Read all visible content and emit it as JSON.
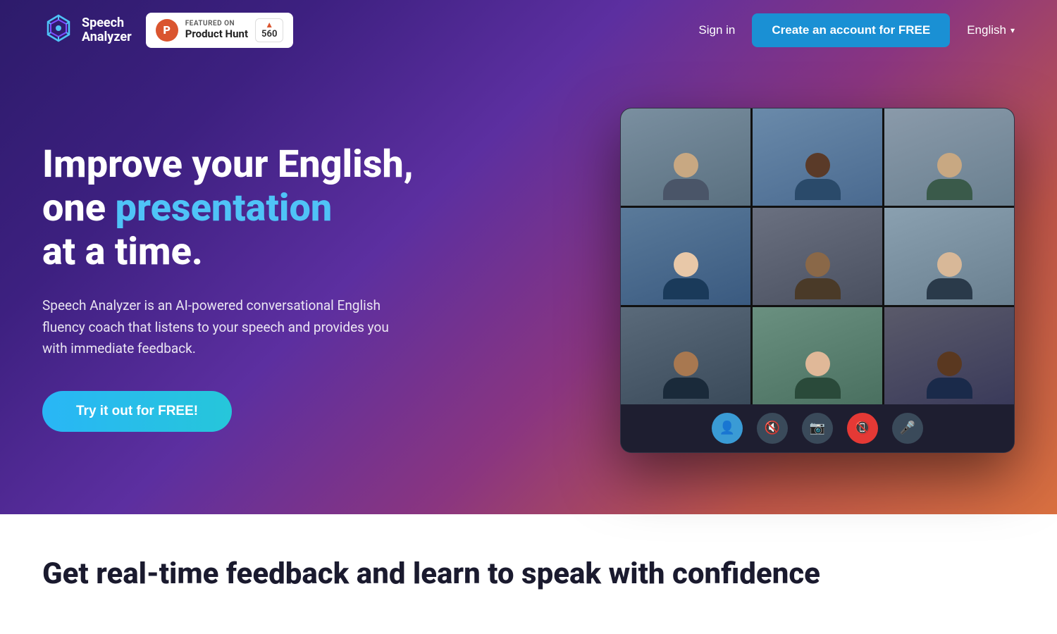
{
  "navbar": {
    "logo_speech": "Speech",
    "logo_analyzer": "Analyzer",
    "product_hunt": {
      "featured_on": "FEATURED ON",
      "name": "Product Hunt",
      "vote_count": "560"
    },
    "sign_in_label": "Sign in",
    "create_account_label": "Create an account for FREE",
    "language_label": "English"
  },
  "hero": {
    "heading_line1": "Improve your English,",
    "heading_line2_prefix": "one ",
    "heading_line2_highlight": "presentation",
    "heading_line3": "at a time.",
    "description": "Speech Analyzer is an AI-powered conversational English fluency coach that listens to your speech and provides you with immediate feedback.",
    "cta_button": "Try it out for FREE!",
    "video_participants": [
      {
        "id": "a",
        "class": "person-a"
      },
      {
        "id": "b",
        "class": "person-b"
      },
      {
        "id": "c",
        "class": "person-c"
      },
      {
        "id": "d",
        "class": "person-d"
      },
      {
        "id": "e",
        "class": "person-e"
      },
      {
        "id": "f",
        "class": "person-f"
      },
      {
        "id": "g",
        "class": "person-g"
      },
      {
        "id": "h",
        "class": "person-h"
      },
      {
        "id": "i",
        "class": "person-i"
      }
    ]
  },
  "bottom_section": {
    "heading": "Get real-time feedback and learn to speak with confidence"
  },
  "colors": {
    "primary_blue": "#1a90d4",
    "highlight": "#4fc3f7",
    "cta_gradient_start": "#29b6f6",
    "cta_gradient_end": "#26c6da",
    "end_call_red": "#e53935"
  }
}
